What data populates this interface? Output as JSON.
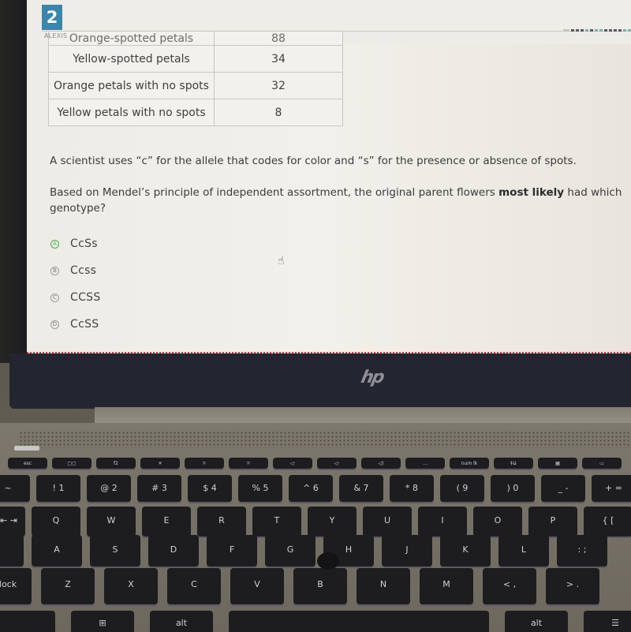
{
  "header": {
    "question_number": "2",
    "user_label": "ALEXIS"
  },
  "table": {
    "rows": [
      {
        "label": "Orange-spotted petals",
        "value": "88"
      },
      {
        "label": "Yellow-spotted petals",
        "value": "34"
      },
      {
        "label": "Orange petals with no spots",
        "value": "32"
      },
      {
        "label": "Yellow petals with no spots",
        "value": "8"
      }
    ]
  },
  "question": {
    "paragraph1": "A scientist uses “c” for the allele that codes for color and “s” for the presence or absence of spots.",
    "paragraph2_before": "Based on Mendel’s principle of independent assortment, the original parent flowers ",
    "paragraph2_bold": "most likely",
    "paragraph2_after": " had which",
    "paragraph2_line2": "genotype?"
  },
  "options": [
    {
      "letter": "A",
      "text": "CcSs",
      "selected": true
    },
    {
      "letter": "B",
      "text": "Ccss",
      "selected": false
    },
    {
      "letter": "C",
      "text": "CCSS",
      "selected": false
    },
    {
      "letter": "D",
      "text": "CcSS",
      "selected": false
    }
  ],
  "colors": {
    "question_badge": "#3b86ad",
    "selected_option": "#56a35c"
  },
  "laptop": {
    "logo": "hp",
    "keys": {
      "fn_row": [
        "esc",
        "▢▢",
        "f2",
        "☀",
        "☼",
        "☼",
        "◁·",
        "◁·",
        "◁)",
        "…",
        "num lk",
        "‡⇊",
        "▦",
        "▭"
      ],
      "number_row": [
        "~",
        "! 1",
        "@ 2",
        "# 3",
        "$ 4",
        "% 5",
        "^ 6",
        "& 7",
        "* 8",
        "( 9",
        ") 0",
        "_ -",
        "+ ="
      ],
      "qwerty_row": [
        "⇤ ⇥",
        "Q",
        "W",
        "E",
        "R",
        "T",
        "Y",
        "U",
        "I",
        "O",
        "P",
        "{ ["
      ],
      "home_row": [
        "",
        "A",
        "S",
        "D",
        "F",
        "G",
        "H",
        "J",
        "K",
        "L",
        ": ;"
      ],
      "bottom_row": [
        "lock",
        "Z",
        "X",
        "C",
        "V",
        "B",
        "N",
        "M",
        "< ,",
        "> ."
      ],
      "space_row": [
        "",
        "⊞",
        "alt",
        "",
        "alt",
        "☰"
      ]
    }
  }
}
